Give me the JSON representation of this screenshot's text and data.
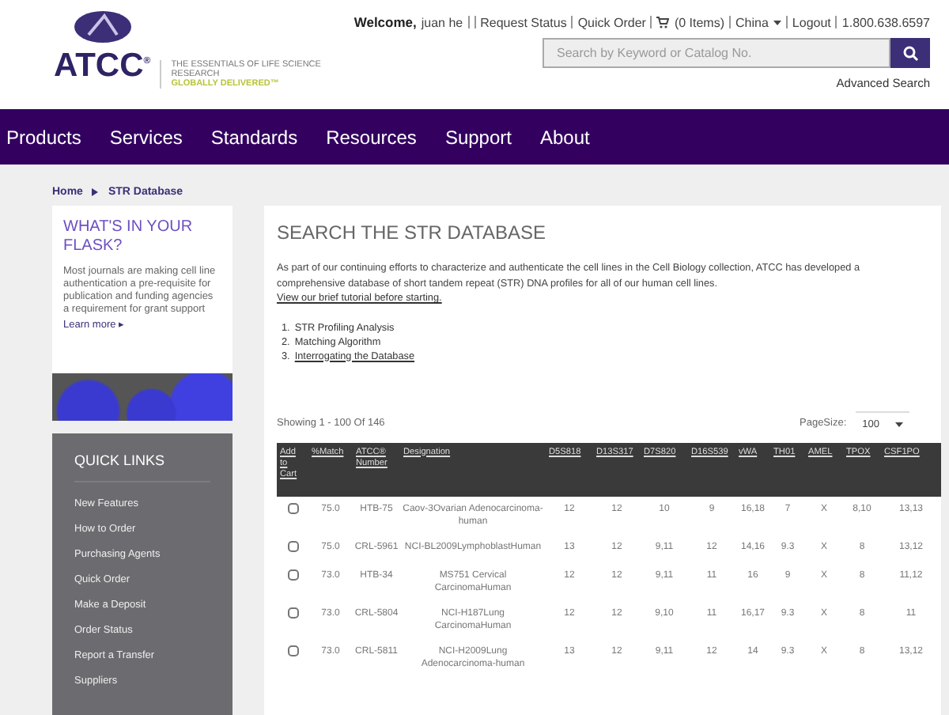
{
  "header": {
    "logo_text": "ATCC",
    "logo_mark": "®",
    "tagline": "THE ESSENTIALS OF LIFE SCIENCE RESEARCH",
    "tagline_sub": "GLOBALLY DELIVERED™",
    "welcome": "Welcome,",
    "user": "juan he",
    "links": [
      "Request Status",
      "Quick Order",
      "(0 Items)",
      "China",
      "Logout",
      "1.800.638.6597"
    ],
    "search": {
      "placeholder": "Search by Keyword or Catalog No."
    },
    "advanced_search": "Advanced Search"
  },
  "nav": [
    "Products",
    "Services",
    "Standards",
    "Resources",
    "Support",
    "About"
  ],
  "breadcrumb": [
    "Home",
    "STR Database"
  ],
  "promo": {
    "title": "WHAT'S IN YOUR FLASK?",
    "body": "Most journals are making cell line authentication a pre-requisite for publication and funding agencies a requirement for grant support",
    "link": "Learn more ▸"
  },
  "quick_links": {
    "title": "QUICK LINKS",
    "items": [
      "New Features",
      "How to Order",
      "Purchasing Agents",
      "Quick Order",
      "Make a Deposit",
      "Order Status",
      "Report a Transfer",
      "Suppliers"
    ]
  },
  "main": {
    "title": "SEARCH THE STR DATABASE",
    "intro": "As part of our continuing efforts to characterize and authenticate the cell lines in the Cell Biology collection, ATCC has developed a comprehensive database of short tandem repeat (STR) DNA profiles for all of our human cell lines.",
    "tutorial_link": "View our brief tutorial before starting.",
    "steps": [
      {
        "number": "1.",
        "label": "STR Profiling Analysis",
        "link": false
      },
      {
        "number": "2.",
        "label": "Matching Algorithm",
        "link": false
      },
      {
        "number": "3.",
        "label": "Interrogating the Database",
        "link": true
      }
    ],
    "showing": "Showing 1 - 100 Of 146",
    "page_size_label": "PageSize:",
    "page_size": "100"
  },
  "table": {
    "columns": [
      "Add to Cart",
      "%Match",
      "ATCC® Number",
      "Designation",
      "D5S818",
      "D13S317",
      "D7S820",
      "D16S539",
      "vWA",
      "TH01",
      "AMEL",
      "TPOX",
      "CSF1PO"
    ],
    "rows": [
      {
        "checked": false,
        "cells": [
          "",
          "75.0",
          "HTB-75",
          "Caov-3Ovarian Adenocarcinoma-human",
          "12",
          "12",
          "10",
          "9",
          "16,18",
          "7",
          "X",
          "8,10",
          "13,13"
        ]
      },
      {
        "checked": false,
        "cells": [
          "",
          "75.0",
          "CRL-5961",
          "NCI-BL2009LymphoblastHuman",
          "13",
          "12",
          "9,11",
          "12",
          "14,16",
          "9.3",
          "X",
          "8",
          "13,12"
        ]
      },
      {
        "checked": false,
        "cells": [
          "",
          "73.0",
          "HTB-34",
          "MS751 Cervical CarcinomaHuman",
          "12",
          "12",
          "9,11",
          "11",
          "16",
          "9",
          "X",
          "8",
          "11,12"
        ]
      },
      {
        "checked": false,
        "cells": [
          "",
          "73.0",
          "CRL-5804",
          "NCI-H187Lung CarcinomaHuman",
          "12",
          "12",
          "9,10",
          "11",
          "16,17",
          "9.3",
          "X",
          "8",
          "11"
        ]
      },
      {
        "checked": false,
        "cells": [
          "",
          "73.0",
          "CRL-5811",
          "NCI-H2009Lung Adenocarcinoma-human",
          "13",
          "12",
          "9,11",
          "12",
          "14",
          "9.3",
          "X",
          "8",
          "13,12"
        ]
      }
    ]
  }
}
